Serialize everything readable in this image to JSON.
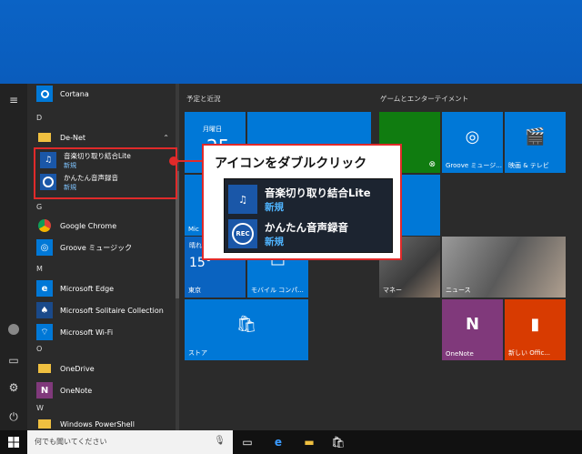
{
  "applist": {
    "cortana": "Cortana",
    "letter_d": "D",
    "denet": "De-Net",
    "sub1_name": "音楽切り取り結合Lite",
    "sub1_badge": "新規",
    "sub2_name": "かんたん音声録音",
    "sub2_badge": "新規",
    "letter_g": "G",
    "chrome": "Google Chrome",
    "groove": "Groove ミュージック",
    "letter_m": "M",
    "edge": "Microsoft Edge",
    "solitaire": "Microsoft Solitaire Collection",
    "wifi": "Microsoft Wi-Fi",
    "letter_o": "O",
    "onedrive": "OneDrive",
    "onenote": "OneNote",
    "letter_w": "W",
    "powershell": "Windows PowerShell"
  },
  "tiles": {
    "group1_title": "予定と近況",
    "group2_title": "ゲームとエンターテイメント",
    "calendar_day": "月曜日",
    "calendar_date": "25",
    "mail_partial": "Mic",
    "weather_label_partial": "晴れ",
    "weather_temp": "15°",
    "weather_city": "東京",
    "mobile": "モバイル コンパ...",
    "store": "ストア",
    "groove": "Groove ミュージ...",
    "movies": "映画 & テレビ",
    "money": "マネー",
    "news": "ニュース",
    "onenote": "OneNote",
    "office": "新しい Offic..."
  },
  "callout": {
    "title": "アイコンをダブルクリック",
    "item1_name": "音楽切り取り結合Lite",
    "item1_badge": "新規",
    "item2_name": "かんたん音声録音",
    "item2_badge": "新規",
    "item2_icon_text": "REC"
  },
  "taskbar": {
    "search_placeholder": "何でも聞いてください"
  },
  "colors": {
    "accent": "#0078d7",
    "highlight_red": "#e02a2a",
    "xbox_green": "#107c10",
    "onenote_purple": "#80397b",
    "office_orange": "#d83b01"
  }
}
